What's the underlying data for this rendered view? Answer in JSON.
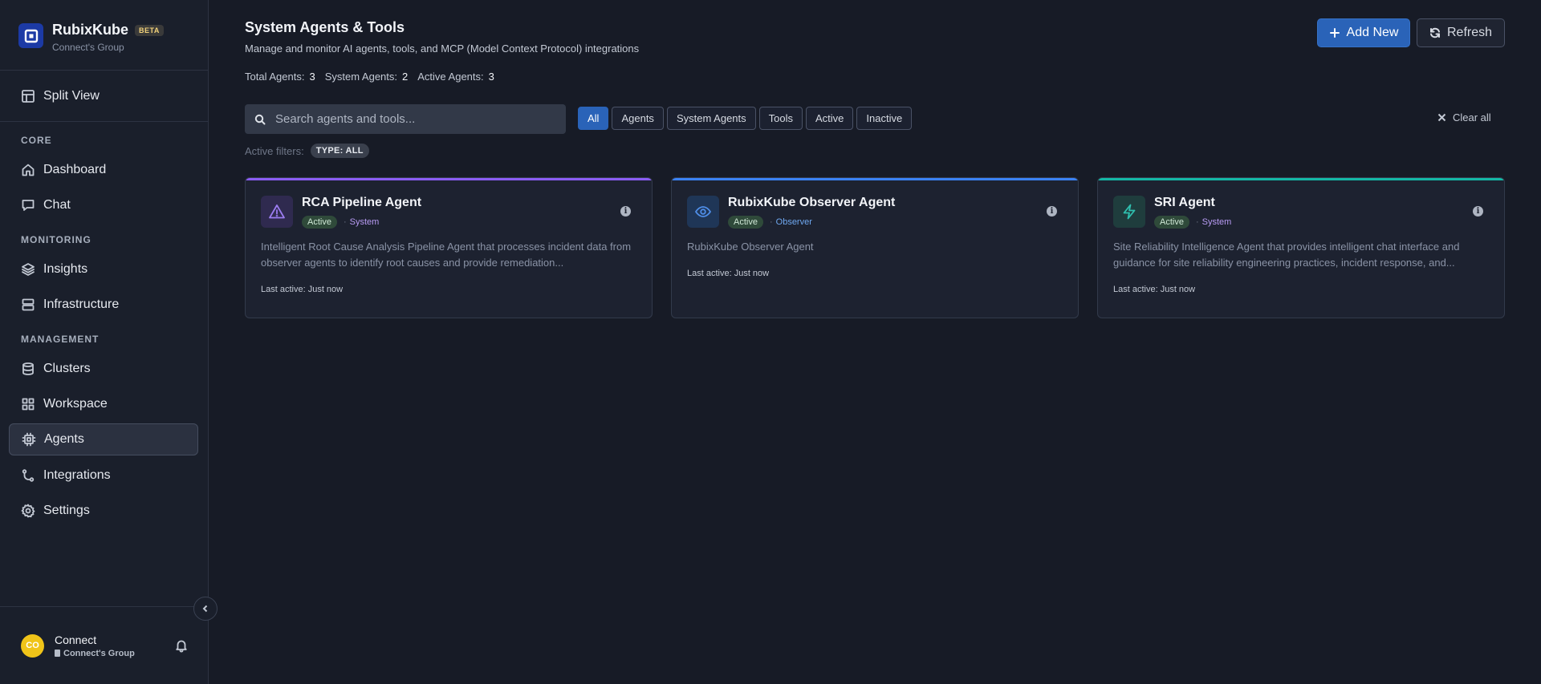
{
  "brand": {
    "name": "RubixKube",
    "badge": "BETA",
    "subtitle": "Connect's Group"
  },
  "sidebar": {
    "split_view": "Split View",
    "sections": {
      "core": "CORE",
      "monitoring": "MONITORING",
      "management": "MANAGEMENT"
    },
    "items": {
      "dashboard": "Dashboard",
      "chat": "Chat",
      "insights": "Insights",
      "infrastructure": "Infrastructure",
      "clusters": "Clusters",
      "workspace": "Workspace",
      "agents": "Agents",
      "integrations": "Integrations",
      "settings": "Settings"
    },
    "active_item": "agents"
  },
  "user": {
    "initials": "CO",
    "name": "Connect",
    "group": "Connect's Group"
  },
  "header": {
    "title": "System Agents & Tools",
    "description": "Manage and monitor AI agents, tools, and MCP (Model Context Protocol) integrations",
    "add_new": "Add New",
    "refresh": "Refresh"
  },
  "stats": {
    "total_label": "Total Agents:",
    "total": "3",
    "system_label": "System Agents:",
    "system": "2",
    "active_label": "Active Agents:",
    "active": "3"
  },
  "search": {
    "placeholder": "Search agents and tools...",
    "value": ""
  },
  "filters": [
    "All",
    "Agents",
    "System Agents",
    "Tools",
    "Active",
    "Inactive"
  ],
  "selected_filter": "All",
  "clear_all": "Clear all",
  "active_filters": {
    "label": "Active filters:",
    "pill": "TYPE: ALL"
  },
  "cards": [
    {
      "name": "RCA Pipeline Agent",
      "status": "Active",
      "type": "System",
      "description": "Intelligent Root Cause Analysis Pipeline Agent that processes incident data from observer agents to identify root causes and provide remediation...",
      "last_active": "Last active: Just now",
      "icon": "alert-triangle-icon",
      "accent": "#8b5cf6"
    },
    {
      "name": "RubixKube Observer Agent",
      "status": "Active",
      "type": "Observer",
      "description": "RubixKube Observer Agent",
      "last_active": "Last active: Just now",
      "icon": "eye-icon",
      "accent": "#3b82f6"
    },
    {
      "name": "SRI Agent",
      "status": "Active",
      "type": "System",
      "description": "Site Reliability Intelligence Agent that provides intelligent chat interface and guidance for site reliability engineering practices, incident response, and...",
      "last_active": "Last active: Just now",
      "icon": "lightning-icon",
      "accent": "#14b8a6"
    }
  ],
  "colors": {
    "primary": "#2a63b8",
    "background": "#171b26",
    "sidebar": "#1a1f2b"
  }
}
